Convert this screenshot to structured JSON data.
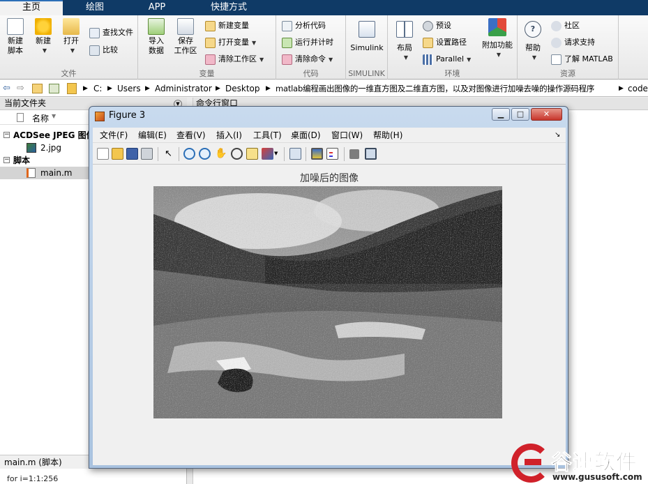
{
  "tabs": [
    "主页",
    "绘图",
    "APP",
    "快捷方式"
  ],
  "ribbon": {
    "file": {
      "label": "文件",
      "new_script": "新建\n脚本",
      "new": "新建",
      "open": "打开",
      "find_files": "查找文件",
      "compare": "比较"
    },
    "variable": {
      "label": "变量",
      "import_data": "导入\n数据",
      "save_workspace": "保存\n工作区",
      "new_variable": "新建变量",
      "open_variable": "打开变量",
      "clear_workspace": "清除工作区"
    },
    "code": {
      "label": "代码",
      "analyze_code": "分析代码",
      "run_and_time": "运行并计时",
      "clear_commands": "清除命令"
    },
    "simulink": {
      "label": "SIMULINK",
      "simulink": "Simulink"
    },
    "environment": {
      "label": "环境",
      "layout": "布局",
      "preferences": "预设",
      "set_path": "设置路径",
      "parallel": "Parallel",
      "add_ons": "附加功能"
    },
    "resources": {
      "label": "资源",
      "help": "帮助",
      "community": "社区",
      "request_support": "请求支持",
      "learn_matlab": "了解 MATLAB"
    }
  },
  "address_bar": {
    "crumbs": [
      "C:",
      "Users",
      "Administrator",
      "Desktop",
      "matlab编程画出图像的一维直方图及二维直方图，以及对图像进行加噪去噪的操作源码程序",
      "code"
    ]
  },
  "current_folder": {
    "title": "当前文件夹",
    "name_column": "名称",
    "tree": [
      {
        "label": "ACDSee JPEG 图像",
        "type": "group"
      },
      {
        "label": "2.jpg",
        "type": "file"
      },
      {
        "label": "脚本",
        "type": "group"
      },
      {
        "label": "main.m",
        "type": "file",
        "selected": true
      }
    ]
  },
  "command_window": {
    "title": "命令行窗口"
  },
  "figure": {
    "title": "Figure 3",
    "menu": [
      "文件(F)",
      "编辑(E)",
      "查看(V)",
      "插入(I)",
      "工具(T)",
      "桌面(D)",
      "窗口(W)",
      "帮助(H)"
    ],
    "toolbar_icons": [
      "new-figure-icon",
      "open-file-icon",
      "save-icon",
      "print-icon",
      "pointer-icon",
      "zoom-in-icon",
      "zoom-out-icon",
      "pan-icon",
      "rotate-3d-icon",
      "data-cursor-icon",
      "brush-icon",
      "link-plot-icon",
      "colorbar-icon",
      "legend-icon",
      "hide-plot-tools-icon",
      "show-plot-tools-icon"
    ],
    "plot_title": "加噪后的图像"
  },
  "details": {
    "script_label": "main.m  (脚本)",
    "code_preview": "for i=1:1:256"
  },
  "watermark": {
    "brand": "谷速软件",
    "url": "www.gususoft.com"
  },
  "colors": {
    "tab_bar": "#0f3a66",
    "active_tab": "#f2f2f2",
    "figure_frame": "#b9cfe8",
    "close_button": "#c7352b",
    "watermark_red": "#d0212a"
  }
}
